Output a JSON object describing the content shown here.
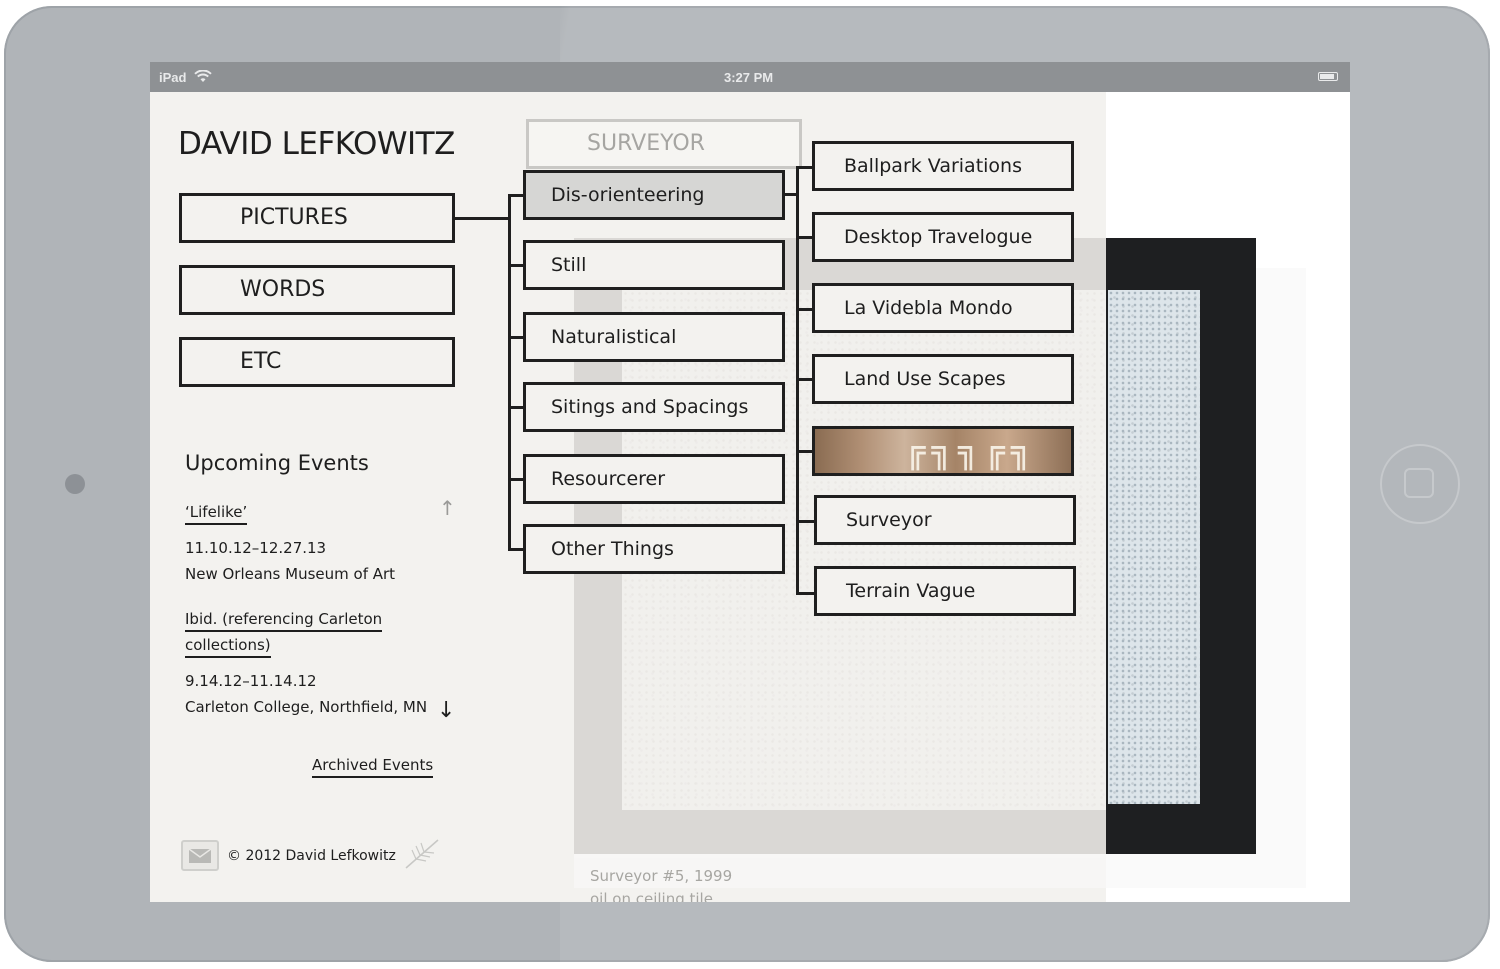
{
  "status_bar": {
    "device": "iPad",
    "time": "3:27 PM"
  },
  "site": {
    "title": "DAVID LEFKOWITZ"
  },
  "nav": {
    "items": [
      {
        "label": "PICTURES"
      },
      {
        "label": "WORDS"
      },
      {
        "label": "ETC"
      }
    ]
  },
  "events": {
    "heading": "Upcoming Events",
    "items": [
      {
        "title": "‘Lifelike’",
        "dates": "11.10.12–12.27.13",
        "venue": "New Orleans Museum of Art"
      },
      {
        "title_line1": "Ibid. (referencing Carleton",
        "title_line2": "collections)",
        "dates": "9.14.12–11.14.12",
        "venue": "Carleton College, Northfield, MN"
      }
    ],
    "archived_label": "Archived Events",
    "scroll_up_icon": "↑",
    "scroll_down_icon": "↓"
  },
  "footer": {
    "copyright": "© 2012 David Lefkowitz",
    "mail_icon": "mail-icon",
    "feather_icon": "feather-icon"
  },
  "pictures_menu": {
    "items": [
      {
        "label": "Dis-orienteering",
        "active": true
      },
      {
        "label": "Still"
      },
      {
        "label": "Naturalistical"
      },
      {
        "label": "Sitings and Spacings"
      },
      {
        "label": "Resourcerer"
      },
      {
        "label": "Other Things"
      }
    ]
  },
  "projects": {
    "header": "SURVEYOR",
    "items": [
      {
        "label": "Ballpark Variations"
      },
      {
        "label": "Desktop Travelogue"
      },
      {
        "label": "La Videbla Mondo"
      },
      {
        "label": "Land Use Scapes"
      },
      {
        "label": "",
        "thumbnail": true
      },
      {
        "label": "Surveyor"
      },
      {
        "label": "Terrain Vague"
      }
    ]
  },
  "artwork": {
    "caption_title": "Surveyor #5, 1999",
    "caption_medium": "oil on ceiling tile"
  }
}
